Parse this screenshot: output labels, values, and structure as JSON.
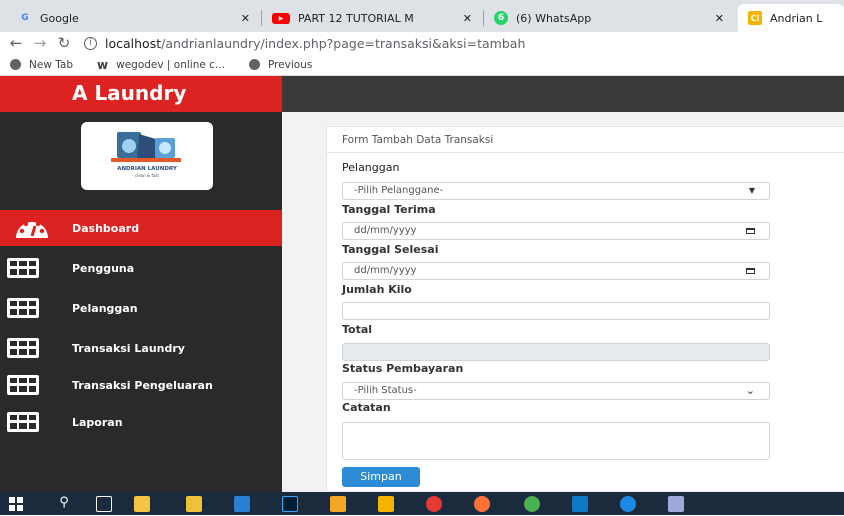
{
  "browser": {
    "tabs": [
      {
        "title": "Google",
        "icon": "google-icon",
        "color": "#4285f4"
      },
      {
        "title": "PART 12 TUTORIAL M",
        "icon": "youtube-icon",
        "color": "#ff0000"
      },
      {
        "title": "(6) WhatsApp",
        "icon": "whatsapp-icon",
        "color": "#25d366",
        "badge": "6"
      },
      {
        "title": "Andrian L",
        "icon": "codeigniter-icon",
        "color": "#f4b400"
      }
    ],
    "url_host": "localhost",
    "url_path": "/andrianlaundry/index.php?page=transaksi&aksi=tambah",
    "bookmarks": [
      "New Tab",
      "wegodev | online c...",
      "Previous"
    ]
  },
  "app": {
    "brand": "A Laundry",
    "logo_text": "ANDRIAN LAUNDRY",
    "logo_tagline": "clean & fast",
    "sidebar": [
      {
        "label": "Dashboard",
        "icon": "dashboard-icon",
        "active": true
      },
      {
        "label": "Pengguna",
        "icon": "table-icon"
      },
      {
        "label": "Pelanggan",
        "icon": "table-icon"
      },
      {
        "label": "Transaksi Laundry",
        "icon": "table-icon"
      },
      {
        "label": "Transaksi Pengeluaran",
        "icon": "table-icon"
      },
      {
        "label": "Laporan",
        "icon": "table-icon"
      }
    ],
    "form": {
      "title": "Form Tambah Data Transaksi",
      "pelanggan_label": "Pelanggan",
      "pelanggan_value": "-Pilih Pelanggane-",
      "tanggal_terima_label": "Tanggal Terima",
      "tanggal_terima_placeholder": "dd/mm/yyyy",
      "tanggal_selesai_label": "Tanggal Selesai",
      "tanggal_selesai_placeholder": "dd/mm/yyyy",
      "jumlah_kilo_label": "Jumlah Kilo",
      "jumlah_kilo_value": "",
      "total_label": "Total",
      "total_value": "",
      "status_label": "Status Pembayaran",
      "status_value": "-Pilih Status-",
      "catatan_label": "Catatan",
      "catatan_value": "",
      "submit_label": "Simpan"
    }
  },
  "colors": {
    "brand_red": "#dd2222",
    "sidebar_bg": "#2a2a2a",
    "button_blue": "#2e8cd6"
  }
}
